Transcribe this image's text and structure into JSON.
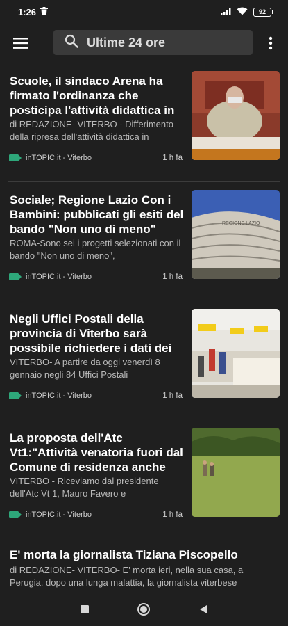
{
  "status": {
    "time": "1:26",
    "battery": "92",
    "icons": [
      "trash-icon",
      "signal-icon",
      "wifi-icon",
      "battery-icon"
    ]
  },
  "app_bar": {
    "search_text": "Ultime 24 ore",
    "icons": [
      "menu-icon",
      "search-icon",
      "more-vert-icon"
    ]
  },
  "colors": {
    "background": "#1f1f1f",
    "search_bg": "#3a3a3a",
    "tag": "#2ea77a",
    "divider": "#3c3c3c"
  },
  "articles": [
    {
      "title": "Scuole, il sindaco Arena ha firmato l'ordinanza che posticipa l'attività didattica in",
      "snippet": "di REDAZIONE- VITERBO - Differimento della ripresa dell'attività didattica in",
      "source": "inTOPIC.it - Viterbo",
      "time": "1 h fa",
      "thumb": "man-at-desk-photo"
    },
    {
      "title": "Sociale; Regione Lazio Con i Bambini: pubblicati gli esiti del bando \"Non uno di meno\"",
      "snippet": "ROMA-Sono sei i progetti selezionati con il bando \"Non uno di meno\",",
      "source": "inTOPIC.it - Viterbo",
      "time": "1 h fa",
      "thumb": "regione-lazio-building-photo",
      "thumb_sign": "REGIONE LAZIO"
    },
    {
      "title": "Negli Uffici Postali della provincia di Viterbo sarà possibile richiedere i dati dei",
      "snippet": "VITERBO- A partire da oggi venerdì 8 gennaio negli 84 Uffici Postali",
      "source": "inTOPIC.it - Viterbo",
      "time": "1 h fa",
      "thumb": "post-office-photo"
    },
    {
      "title": "La proposta dell'Atc Vt1:\"Attività venatoria fuori dal Comune di residenza anche",
      "snippet": "VITERBO - Riceviamo dal presidente dell'Atc Vt 1, Mauro Favero e",
      "source": "inTOPIC.it - Viterbo",
      "time": "1 h fa",
      "thumb": "hunters-field-photo"
    }
  ],
  "last_article": {
    "title": "E' morta la giornalista Tiziana Piscopello",
    "snippet": "di REDAZIONE- VITERBO- E' morta ieri, nella sua casa, a Perugia, dopo una lunga malattia, la giornalista viterbese"
  },
  "nav": [
    "recents-icon",
    "home-icon",
    "back-icon"
  ]
}
